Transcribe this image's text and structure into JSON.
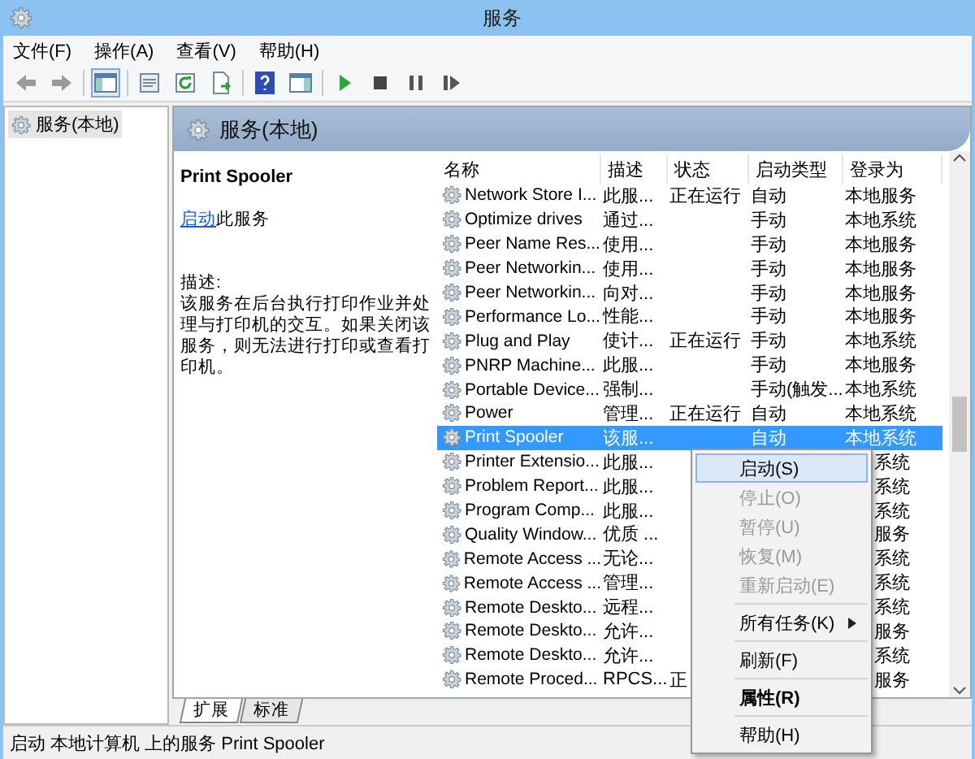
{
  "window": {
    "title": "服务"
  },
  "menu": [
    "文件(F)",
    "操作(A)",
    "查看(V)",
    "帮助(H)"
  ],
  "toolbar": [
    {
      "kind": "back"
    },
    {
      "kind": "forward"
    },
    {
      "kind": "sep"
    },
    {
      "kind": "tree",
      "selected": true
    },
    {
      "kind": "sep"
    },
    {
      "kind": "props"
    },
    {
      "kind": "refresh"
    },
    {
      "kind": "export"
    },
    {
      "kind": "sep"
    },
    {
      "kind": "help"
    },
    {
      "kind": "pane"
    },
    {
      "kind": "sep"
    },
    {
      "kind": "play"
    },
    {
      "kind": "stop"
    },
    {
      "kind": "pause"
    },
    {
      "kind": "resume"
    }
  ],
  "tree": {
    "items": [
      {
        "label": "服务(本地)",
        "selected": true
      }
    ]
  },
  "panel": {
    "title": "服务(本地)"
  },
  "details": {
    "service_name": "Print Spooler",
    "action_link": "启动",
    "action_text": "此服务",
    "description_label": "描述:",
    "description": "该服务在后台执行打印作业并处理与打印机的交互。如果关闭该服务，则无法进行打印或查看打印机。"
  },
  "table": {
    "columns": [
      "名称",
      "描述",
      "状态",
      "启动类型",
      "登录为"
    ],
    "rows": [
      {
        "name": "Network Store I...",
        "desc": "此服...",
        "status": "正在运行",
        "startup": "自动",
        "logon": "本地服务",
        "selected": false,
        "partly_hidden": false
      },
      {
        "name": "Optimize drives",
        "desc": "通过...",
        "startup": "手动",
        "logon": "本地系统",
        "selected": false,
        "partly_hidden": false
      },
      {
        "name": "Peer Name Res...",
        "desc": "使用...",
        "startup": "手动",
        "logon": "本地服务",
        "selected": false,
        "partly_hidden": false
      },
      {
        "name": "Peer Networkin...",
        "desc": "使用...",
        "startup": "手动",
        "logon": "本地服务",
        "selected": false,
        "partly_hidden": false
      },
      {
        "name": "Peer Networkin...",
        "desc": "向对...",
        "startup": "手动",
        "logon": "本地服务",
        "selected": false,
        "partly_hidden": false
      },
      {
        "name": "Performance Lo...",
        "desc": "性能...",
        "startup": "手动",
        "logon": "本地服务",
        "selected": false,
        "partly_hidden": false
      },
      {
        "name": "Plug and Play",
        "desc": "使计...",
        "status": "正在运行",
        "startup": "手动",
        "logon": "本地系统",
        "selected": false,
        "partly_hidden": false
      },
      {
        "name": "PNRP Machine...",
        "desc": "此服...",
        "startup": "手动",
        "logon": "本地服务",
        "selected": false,
        "partly_hidden": false
      },
      {
        "name": "Portable Device...",
        "desc": "强制...",
        "startup": "手动(触发...",
        "logon": "本地系统",
        "selected": false,
        "partly_hidden": false
      },
      {
        "name": "Power",
        "desc": "管理...",
        "status": "正在运行",
        "startup": "自动",
        "logon": "本地系统",
        "selected": false,
        "partly_hidden": false
      },
      {
        "name": "Print Spooler",
        "desc": "该服...",
        "startup": "自动",
        "logon": "本地系统",
        "selected": true,
        "partly_hidden": false
      },
      {
        "name": "Printer Extensio...",
        "desc": "此服...",
        "logon": "系统",
        "selected": false,
        "partly_hidden": true
      },
      {
        "name": "Problem Report...",
        "desc": "此服...",
        "logon": "系统",
        "selected": false,
        "partly_hidden": true
      },
      {
        "name": "Program Comp...",
        "desc": "此服...",
        "logon": "系统",
        "selected": false,
        "partly_hidden": true
      },
      {
        "name": "Quality Window...",
        "desc": "优质 ...",
        "logon": "服务",
        "selected": false,
        "partly_hidden": true
      },
      {
        "name": "Remote Access ...",
        "desc": "无论...",
        "logon": "系统",
        "selected": false,
        "partly_hidden": true
      },
      {
        "name": "Remote Access ...",
        "desc": "管理...",
        "logon": "系统",
        "selected": false,
        "partly_hidden": true
      },
      {
        "name": "Remote Deskto...",
        "desc": "远程...",
        "logon": "系统",
        "selected": false,
        "partly_hidden": true
      },
      {
        "name": "Remote Deskto...",
        "desc": "允许...",
        "logon": "服务",
        "selected": false,
        "partly_hidden": true
      },
      {
        "name": "Remote Deskto...",
        "desc": "允许...",
        "logon": "系统",
        "selected": false,
        "partly_hidden": true
      },
      {
        "name": "Remote Proced...",
        "desc": "RPCS...",
        "status": "正",
        "logon": "服务",
        "selected": false,
        "partly_hidden": true
      }
    ]
  },
  "context_menu": {
    "items": [
      {
        "kind": "item",
        "label": "启动(S)",
        "disabled": false,
        "selected": true,
        "default": false,
        "submenu": false
      },
      {
        "kind": "item",
        "label": "停止(O)",
        "disabled": true,
        "selected": false,
        "default": false,
        "submenu": false
      },
      {
        "kind": "item",
        "label": "暂停(U)",
        "disabled": true,
        "selected": false,
        "default": false,
        "submenu": false
      },
      {
        "kind": "item",
        "label": "恢复(M)",
        "disabled": true,
        "selected": false,
        "default": false,
        "submenu": false
      },
      {
        "kind": "item",
        "label": "重新启动(E)",
        "disabled": true,
        "selected": false,
        "default": false,
        "submenu": false
      },
      {
        "kind": "separator"
      },
      {
        "kind": "item",
        "label": "所有任务(K)",
        "disabled": false,
        "selected": false,
        "default": false,
        "submenu": true
      },
      {
        "kind": "separator"
      },
      {
        "kind": "item",
        "label": "刷新(F)",
        "disabled": false,
        "selected": false,
        "default": false,
        "submenu": false
      },
      {
        "kind": "separator"
      },
      {
        "kind": "item",
        "label": "属性(R)",
        "disabled": false,
        "selected": false,
        "default": true,
        "submenu": false
      },
      {
        "kind": "separator"
      },
      {
        "kind": "item",
        "label": "帮助(H)",
        "disabled": false,
        "selected": false,
        "default": false,
        "submenu": false
      }
    ]
  },
  "tabs": [
    {
      "label": "扩展",
      "selected": true
    },
    {
      "label": "标准",
      "selected": false
    }
  ],
  "status_bar": "启动 本地计算机 上的服务 Print Spooler"
}
